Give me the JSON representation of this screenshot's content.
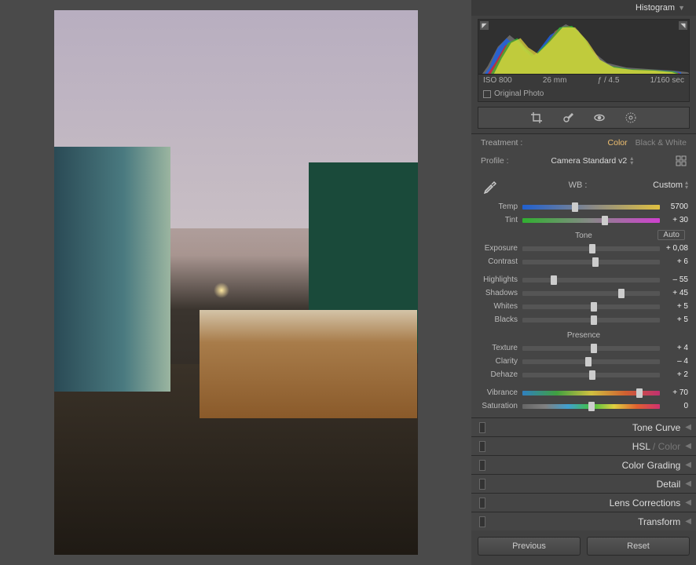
{
  "header": {
    "histogram": "Histogram"
  },
  "hist_meta": {
    "iso": "ISO 800",
    "focal": "26 mm",
    "aperture": "ƒ / 4.5",
    "shutter": "1/160 sec"
  },
  "original_photo": "Original Photo",
  "treatment": {
    "label": "Treatment :",
    "color": "Color",
    "bw": "Black & White"
  },
  "profile": {
    "label": "Profile :",
    "value": "Camera Standard v2"
  },
  "wb": {
    "label": "WB :",
    "value": "Custom"
  },
  "sliders": {
    "temp": {
      "label": "Temp",
      "value": "5700",
      "pos": 38
    },
    "tint": {
      "label": "Tint",
      "value": "+ 30",
      "pos": 60
    },
    "exposure": {
      "label": "Exposure",
      "value": "+ 0,08",
      "pos": 51
    },
    "contrast": {
      "label": "Contrast",
      "value": "+ 6",
      "pos": 53
    },
    "highlights": {
      "label": "Highlights",
      "value": "– 55",
      "pos": 23
    },
    "shadows": {
      "label": "Shadows",
      "value": "+ 45",
      "pos": 72
    },
    "whites": {
      "label": "Whites",
      "value": "+ 5",
      "pos": 52
    },
    "blacks": {
      "label": "Blacks",
      "value": "+ 5",
      "pos": 52
    },
    "texture": {
      "label": "Texture",
      "value": "+ 4",
      "pos": 52
    },
    "clarity": {
      "label": "Clarity",
      "value": "– 4",
      "pos": 48
    },
    "dehaze": {
      "label": "Dehaze",
      "value": "+ 2",
      "pos": 51
    },
    "vibrance": {
      "label": "Vibrance",
      "value": "+ 70",
      "pos": 85
    },
    "saturation": {
      "label": "Saturation",
      "value": "0",
      "pos": 50
    }
  },
  "sections": {
    "tone": "Tone",
    "auto": "Auto",
    "presence": "Presence"
  },
  "collapsed": {
    "tone_curve": "Tone Curve",
    "hsl": "HSL",
    "hsl_sep": " / ",
    "hsl_color": "Color",
    "color_grading": "Color Grading",
    "detail": "Detail",
    "lens": "Lens Corrections",
    "transform": "Transform"
  },
  "buttons": {
    "previous": "Previous",
    "reset": "Reset"
  }
}
